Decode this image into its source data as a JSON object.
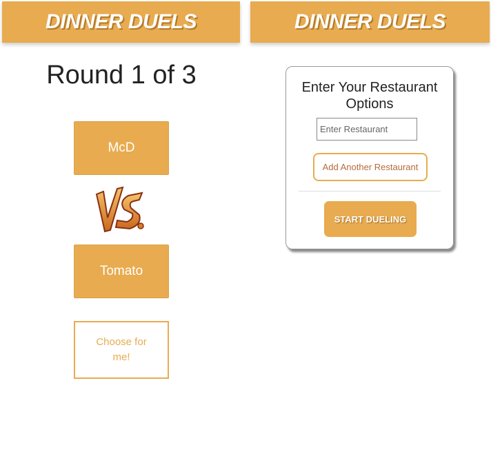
{
  "left_screen": {
    "header_title": "DINNER DUELS",
    "round_label": "Round 1 of 3",
    "option_a": "McD",
    "option_b": "Tomato",
    "vs_icon": "vs-logo",
    "vs_text": "VS",
    "choose_button": "Choose for me!"
  },
  "right_screen": {
    "header_title": "DINNER DUELS",
    "card_title": "Enter Your Restaurant Options",
    "restaurant_input": {
      "value": "",
      "placeholder": "Enter Restaurant"
    },
    "add_button": "Add Another Restaurant",
    "start_button": "START DUELING"
  },
  "colors": {
    "accent": "#e8ab4f",
    "add_text": "#b66a3a"
  }
}
